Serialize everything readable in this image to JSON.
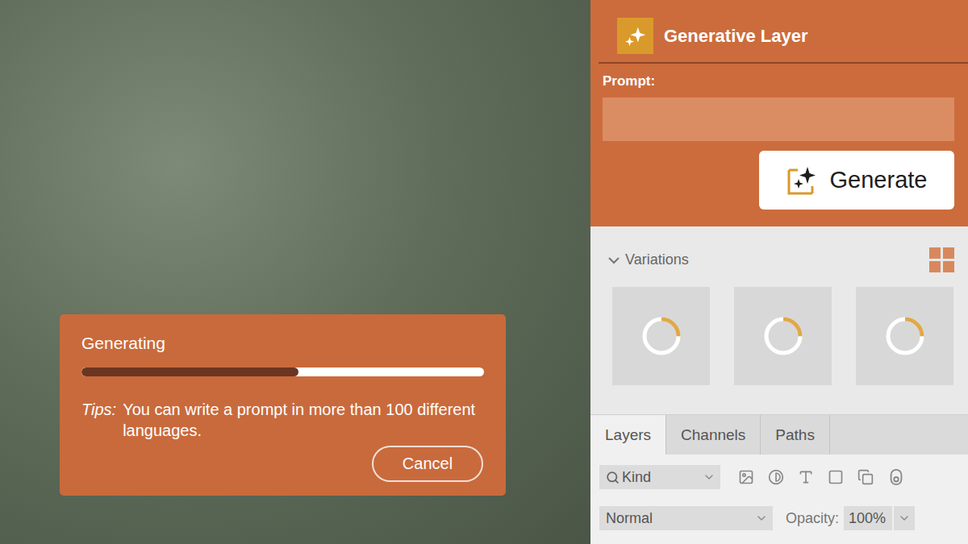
{
  "panel": {
    "title": "Generative Layer",
    "prompt_label": "Prompt:",
    "generate_button": "Generate"
  },
  "variations": {
    "label": "Variations",
    "expanded": true,
    "tiles": [
      {
        "loading": true,
        "level": 0.25
      },
      {
        "loading": true,
        "level": 0.25
      },
      {
        "loading": true,
        "level": 0.25
      }
    ]
  },
  "tabs": [
    {
      "label": "Layers",
      "selected": true
    },
    {
      "label": "Channels",
      "selected": false
    },
    {
      "label": "Paths",
      "selected": false
    }
  ],
  "layers": {
    "filter": "Kind",
    "blend_mode": "Normal",
    "opacity_label": "Opacity:",
    "opacity": "100%"
  },
  "dialog": {
    "title": "Generating",
    "level": 0.54,
    "tip_label": "Tips:",
    "tip": "You can write a prompt in more than 100 different languages.",
    "cancel_button": "Cancel"
  }
}
